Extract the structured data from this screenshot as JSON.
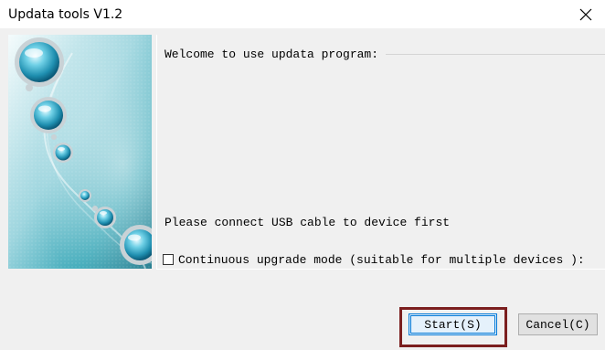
{
  "window": {
    "title": "Updata tools V1.2",
    "close_glyph": "✕"
  },
  "content": {
    "welcome_text": "Welcome to use updata program:",
    "connect_text": "Please connect USB cable to device first",
    "continuous_mode": {
      "label": "Continuous upgrade mode (suitable for multiple devices ):",
      "checked": false
    }
  },
  "buttons": {
    "start_label": "Start(S)",
    "cancel_label": "Cancel(C)"
  },
  "colors": {
    "highlight_border": "#7b1e1e",
    "default_button_border": "#0078d7",
    "window_bg": "#f0f0f0"
  },
  "icons": {
    "close": "close-icon",
    "side_image": "bubbles-decorative-image"
  }
}
